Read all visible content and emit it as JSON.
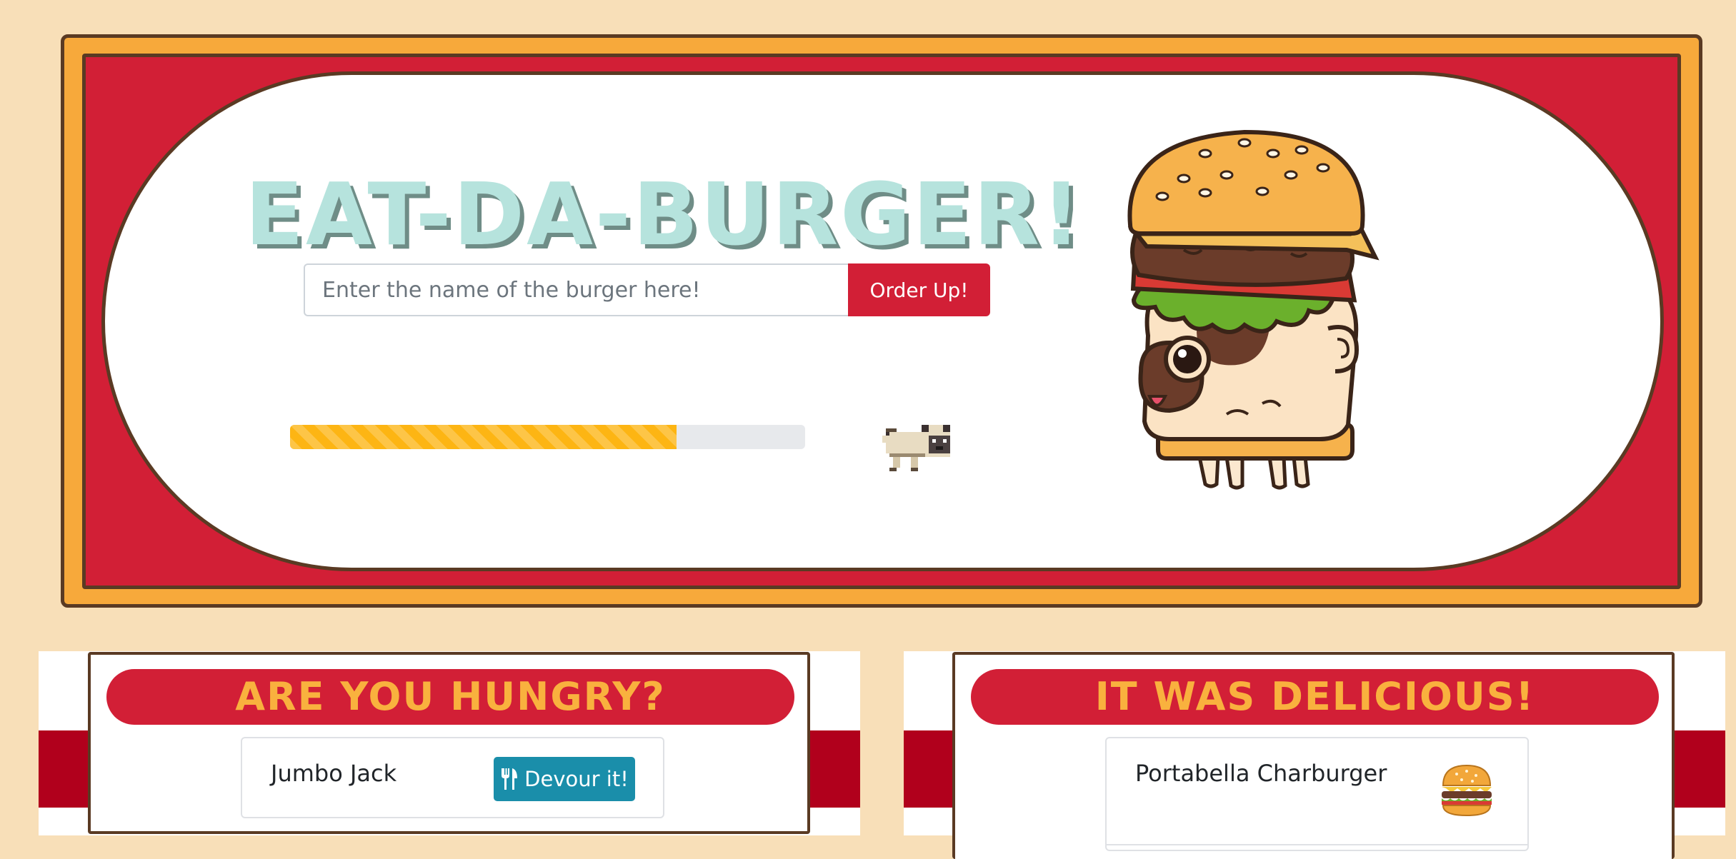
{
  "hero": {
    "title": "EAT-DA-BURGER!",
    "input_placeholder": "Enter the name of the burger here!",
    "order_button_label": "Order Up!",
    "progress_fraction": 0.75
  },
  "panels": {
    "hungry": {
      "title": "ARE YOU HUNGRY?",
      "burgers": [
        {
          "name": "Jumbo Jack",
          "action_label": "Devour it!",
          "action_icon": "utensils-icon"
        }
      ]
    },
    "delicious": {
      "title": "IT WAS DELICIOUS!",
      "burgers": [
        {
          "name": "Portabella Charburger",
          "icon": "hamburger-icon"
        }
      ]
    }
  },
  "colors": {
    "page_background": "#f8dfb8",
    "frame_orange": "#f7a93b",
    "frame_red": "#d21f36",
    "title_mint": "#b6e3dd",
    "header_text": "#f9b13e",
    "devour_button": "#1a8eaa",
    "progress_yellow": "#fdb513"
  }
}
